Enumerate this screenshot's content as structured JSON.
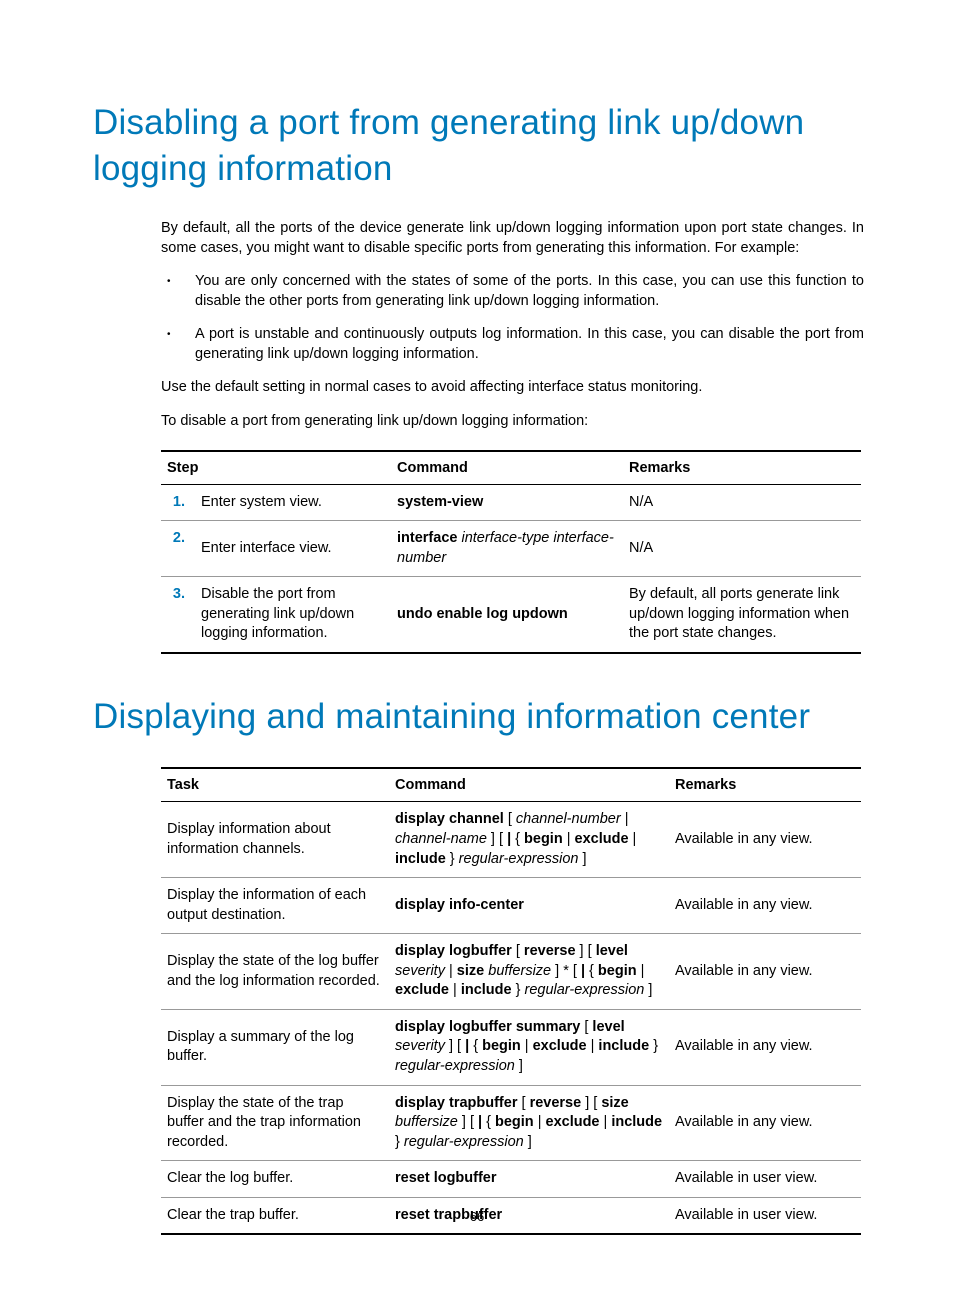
{
  "heading1": "Disabling a port from generating link up/down logging information",
  "para1": "By default, all the ports of the device generate link up/down logging information upon port state changes. In some cases, you might want to disable specific ports from generating this information. For example:",
  "bullets": [
    "You are only concerned with the states of some of the ports. In this case, you can use this function to disable the other ports from generating link up/down logging information.",
    "A port is unstable and continuously outputs log information. In this case, you can disable the port from generating link up/down logging information."
  ],
  "para2": "Use the default setting in normal cases to avoid affecting interface status monitoring.",
  "para3": "To disable a port from generating link up/down logging information:",
  "table1": {
    "headers": {
      "step": "Step",
      "command": "Command",
      "remarks": "Remarks"
    },
    "rows": [
      {
        "num": "1.",
        "step": "Enter system view.",
        "command_html": "<span class='bold'>system-view</span>",
        "remarks": "N/A"
      },
      {
        "num": "2.",
        "step": "Enter interface view.",
        "command_html": "<span class='bold'>interface</span> <span class='italic'>interface-type interface-number</span>",
        "remarks": "N/A"
      },
      {
        "num": "3.",
        "step": "Disable the port from generating link up/down logging information.",
        "command_html": "<span class='bold'>undo enable log updown</span>",
        "remarks": "By default, all ports generate link up/down logging information when the port state changes."
      }
    ]
  },
  "heading2": "Displaying and maintaining information center",
  "table2": {
    "headers": {
      "task": "Task",
      "command": "Command",
      "remarks": "Remarks"
    },
    "rows": [
      {
        "task": "Display information about information channels.",
        "command_html": "<span class='bold'>display channel</span> [ <span class='italic'>channel-number</span> | <span class='italic'>channel-name</span> ] [ <span class='bold'>|</span> { <span class='bold'>begin</span> | <span class='bold'>exclude</span> | <span class='bold'>include</span> } <span class='italic'>regular-expression</span> ]",
        "remarks": "Available in any view."
      },
      {
        "task": "Display the information of each output destination.",
        "command_html": "<span class='bold'>display info-center</span>",
        "remarks": "Available in any view."
      },
      {
        "task": "Display the state of the log buffer and the log information recorded.",
        "command_html": "<span class='bold'>display logbuffer</span> [ <span class='bold'>reverse</span> ] [ <span class='bold'>level</span> <span class='italic'>severity</span> | <span class='bold'>size</span> <span class='italic'>buffersize</span> ] * [ <span class='bold'>|</span> { <span class='bold'>begin</span> | <span class='bold'>exclude</span> | <span class='bold'>include</span> } <span class='italic'>regular-expression</span> ]",
        "remarks": "Available in any view."
      },
      {
        "task": "Display a summary of the log buffer.",
        "command_html": "<span class='bold'>display logbuffer summary</span> [ <span class='bold'>level</span> <span class='italic'>severity</span> ] [ <span class='bold'>|</span> { <span class='bold'>begin</span> | <span class='bold'>exclude</span> | <span class='bold'>include</span> } <span class='italic'>regular-expression</span> ]",
        "remarks": "Available in any view."
      },
      {
        "task": "Display the state of the trap buffer and the trap information recorded.",
        "command_html": "<span class='bold'>display trapbuffer</span> [ <span class='bold'>reverse</span> ] [ <span class='bold'>size</span> <span class='italic'>buffersize</span> ] [ <span class='bold'>|</span> { <span class='bold'>begin</span> | <span class='bold'>exclude</span> | <span class='bold'>include</span> } <span class='italic'>regular-expression</span> ]",
        "remarks": "Available in any view."
      },
      {
        "task": "Clear the log buffer.",
        "command_html": "<span class='bold'>reset logbuffer</span>",
        "remarks": "Available in user view."
      },
      {
        "task": "Clear the trap buffer.",
        "command_html": "<span class='bold'>reset trapbuffer</span>",
        "remarks": "Available in user view."
      }
    ]
  },
  "page_number": "66"
}
